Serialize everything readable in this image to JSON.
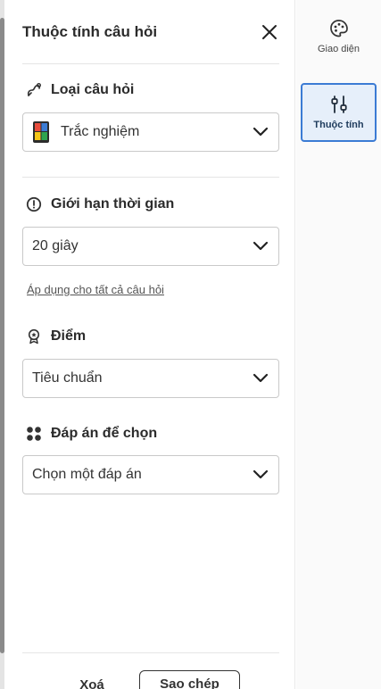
{
  "panel": {
    "title": "Thuộc tính câu hỏi",
    "close_icon": "close-icon"
  },
  "question_type": {
    "label": "Loại câu hỏi",
    "icon": "question-type-icon",
    "selected": "Trắc nghiệm"
  },
  "time_limit": {
    "label": "Giới hạn thời gian",
    "icon": "timer-icon",
    "selected": "20 giây",
    "apply_all_link": "Áp dụng cho tất cả câu hỏi"
  },
  "points": {
    "label": "Điểm",
    "icon": "award-icon",
    "selected": "Tiêu chuẩn"
  },
  "answer_options": {
    "label": "Đáp án để chọn",
    "icon": "dots-grid-icon",
    "selected": "Chọn một đáp án"
  },
  "footer": {
    "delete_label": "Xoá",
    "copy_label": "Sao chép"
  },
  "rail": {
    "items": [
      {
        "label": "Giao diện",
        "icon": "palette-icon",
        "active": false
      },
      {
        "label": "Thuộc tính",
        "icon": "sliders-icon",
        "active": true
      }
    ]
  },
  "colors": {
    "accent": "#3b7bd4",
    "active_bg": "#e6effa",
    "text": "#2b2b2b"
  }
}
